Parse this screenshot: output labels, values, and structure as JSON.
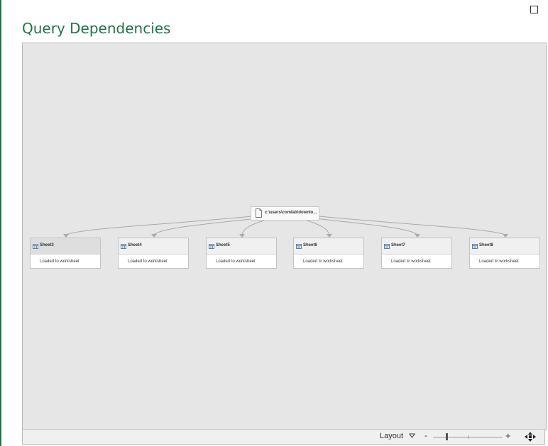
{
  "window": {
    "title": "Query Dependencies"
  },
  "colors": {
    "accent": "#217346",
    "canvas": "#e6e6e6",
    "connector": "#a9a9a9"
  },
  "source_node": {
    "label": "c:\\users\\comlab\\downlo...",
    "icon": "document-icon"
  },
  "query_nodes": [
    {
      "name": "Sheet3",
      "status": "Loaded to worksheet",
      "icon": "table-icon",
      "selected": true
    },
    {
      "name": "Sheet4",
      "status": "Loaded to worksheet",
      "icon": "table-icon"
    },
    {
      "name": "Sheet5",
      "status": "Loaded to worksheet",
      "icon": "table-icon"
    },
    {
      "name": "Sheet6",
      "status": "Loaded to worksheet",
      "icon": "table-icon"
    },
    {
      "name": "Sheet7",
      "status": "Loaded to worksheet",
      "icon": "table-icon"
    },
    {
      "name": "Sheet8",
      "status": "Loaded to worksheet",
      "icon": "table-icon"
    }
  ],
  "status_bar": {
    "layout_label": "Layout",
    "zoom_minus": "-",
    "zoom_plus": "+",
    "zoom_level": 0.2
  }
}
